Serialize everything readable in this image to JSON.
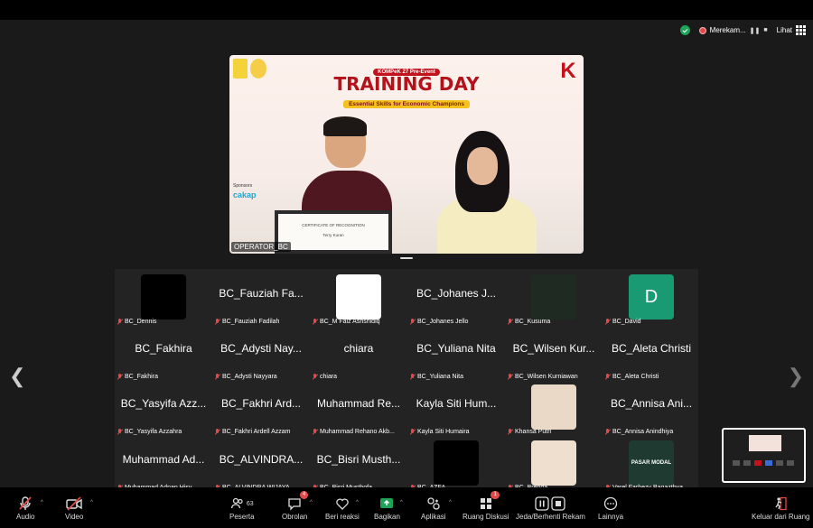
{
  "status": {
    "recording_label": "Merekam...",
    "pause_glyph": "❚❚",
    "stop_glyph": "■",
    "view_label": "Lihat"
  },
  "speaker": {
    "name": "OPERATOR_BC",
    "banner_pre": "KOMPeK 27 Pre-Event",
    "banner_title": "TRAINING DAY",
    "banner_sub": "Essential Skills for Economic Champions",
    "sponsor_label": "Sponsors",
    "sponsor_name": "cakap",
    "cert_title": "CERTIFICATE OF RECOGNITION",
    "cert_name": "Terry Kuran",
    "logo_letter": "K"
  },
  "participants": [
    {
      "big": "",
      "name": "BC_Dennis",
      "video": "#000000"
    },
    {
      "big": "BC_Fauziah Fa...",
      "name": "BC_Fauziah Fadilah"
    },
    {
      "big": "",
      "name": "BC_M Faiz Ashshidiq",
      "video": "#ffffff"
    },
    {
      "big": "BC_Johanes J...",
      "name": "BC_Johanes Jello"
    },
    {
      "big": "",
      "name": "BC_Kusuma",
      "video": "#1e2a22"
    },
    {
      "big": "",
      "name": "BC_David",
      "avatar": "D",
      "avatar_color": "#1a9a73"
    },
    {
      "big": "BC_Fakhira",
      "name": "BC_Fakhira"
    },
    {
      "big": "BC_Adysti Nay...",
      "name": "BC_Adysti Nayyara"
    },
    {
      "big": "chiara",
      "name": "chiara"
    },
    {
      "big": "BC_Yuliana Nita",
      "name": "BC_Yuliana Nita"
    },
    {
      "big": "BC_Wilsen Kur...",
      "name": "BC_Wilsen Kurniawan"
    },
    {
      "big": "BC_Aleta Christi",
      "name": "BC_Aleta Christi"
    },
    {
      "big": "BC_Yasyifa Azz...",
      "name": "BC_Yasyifa Azzahra"
    },
    {
      "big": "BC_Fakhri Ard...",
      "name": "BC_Fakhri Ardell Azzam"
    },
    {
      "big": "Muhammad Re...",
      "name": "Muhammad Rehano Akb..."
    },
    {
      "big": "Kayla Siti Hum...",
      "name": "Kayla Siti Humaira"
    },
    {
      "big": "",
      "name": "Khansa Putri",
      "video": "#e9d9c6"
    },
    {
      "big": "BC_Annisa Ani...",
      "name": "BC_Annisa Anindhiya"
    },
    {
      "big": "Muhammad Ad...",
      "name": "Muhammad Adnan Hisy..."
    },
    {
      "big": "BC_ALVINDRA...",
      "name": "BC_ALVINDRA WIJAYA"
    },
    {
      "big": "BC_Bisri Musth...",
      "name": "BC_Bisri Musthofa"
    },
    {
      "big": "",
      "name": "BC_AZFA",
      "video": "#000000"
    },
    {
      "big": "",
      "name": "BC_Brenda",
      "video": "#eedfcf"
    },
    {
      "big": "",
      "name": "Varel Farhezy Bagazthya",
      "video": "#1f3a30",
      "video_text": "PASAR MODAL"
    }
  ],
  "toolbar": {
    "audio": "Audio",
    "video": "Video",
    "participants": "Peserta",
    "participants_count": "63",
    "chat": "Obrolan",
    "chat_badge": "4",
    "reactions": "Beri reaksi",
    "share": "Bagikan",
    "apps": "Aplikasi",
    "breakout": "Ruang Diskusi",
    "breakout_badge": "1",
    "recording": "Jeda/Berhenti Rekam",
    "more": "Lainnya",
    "leave": "Keluar dari Ruang"
  },
  "colors": {
    "accent_green": "#1fa35a",
    "mute_red": "#e24a4a",
    "banner_red": "#b4121b"
  }
}
